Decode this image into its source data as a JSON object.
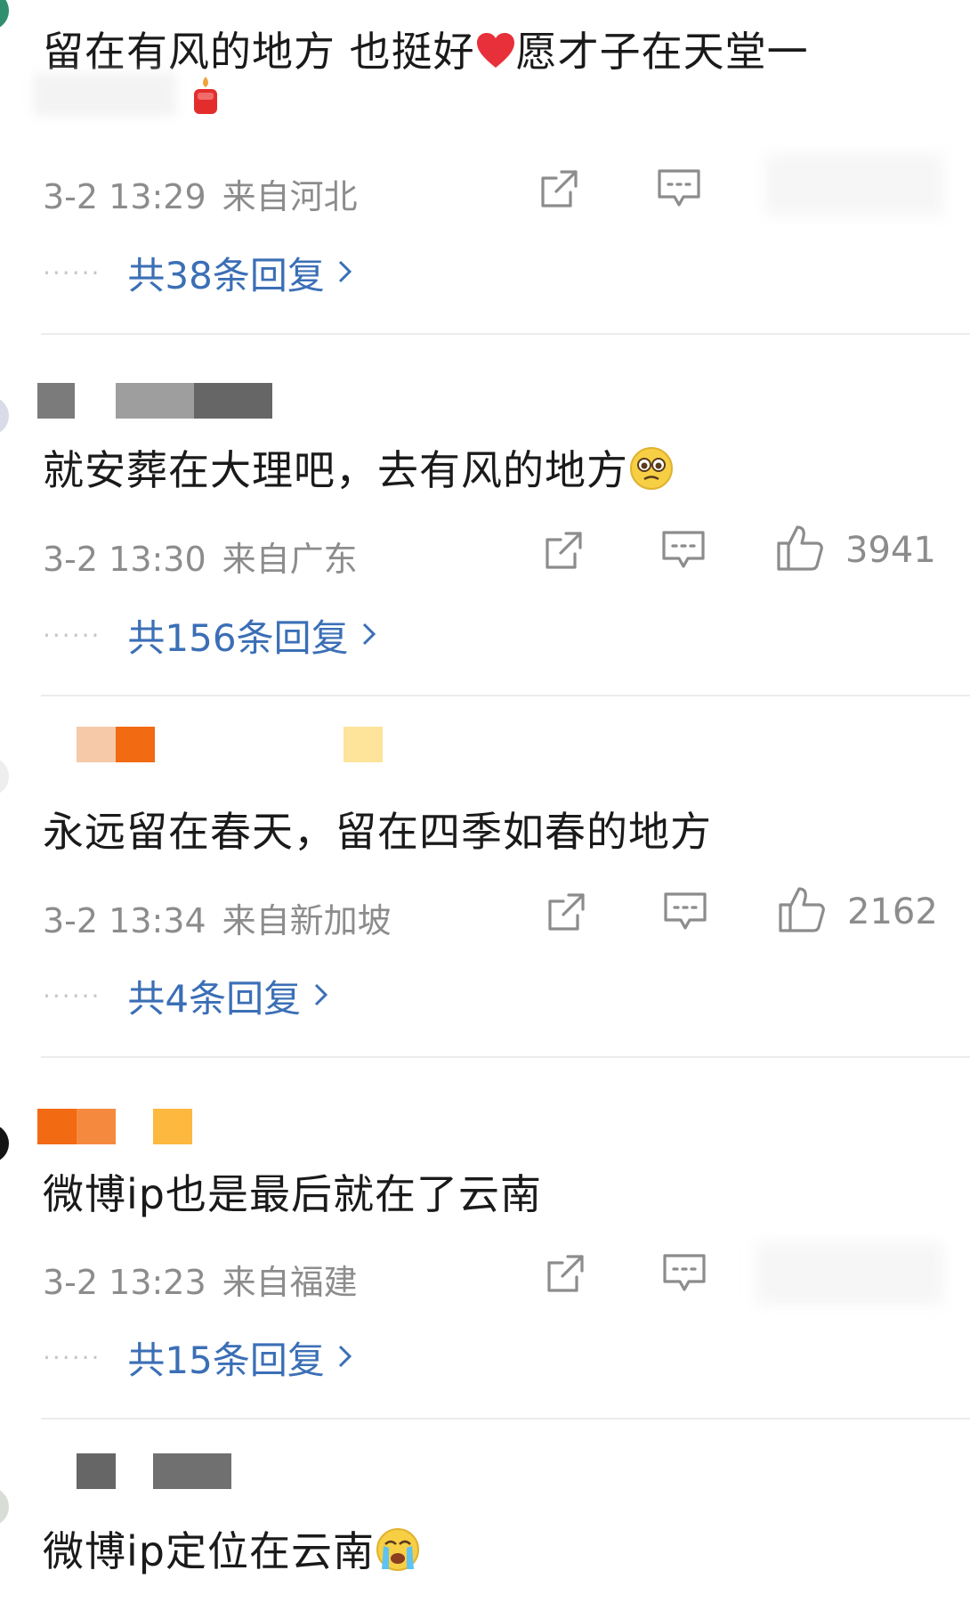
{
  "colors": {
    "text": "#1a1a1a",
    "meta": "#8c8c8c",
    "link": "#3b6fb6",
    "divider": "#ececec"
  },
  "icons": {
    "share": "share-icon",
    "comment": "comment-icon",
    "like": "like-icon",
    "heart": "heart-emoji",
    "pleading": "pleading-face-emoji",
    "crying": "crying-face-emoji",
    "candle": "candle-sticker"
  },
  "comments": [
    {
      "text_a": "留在有风的地方 也挺好",
      "text_b": "愿才子在天堂一",
      "time": "3-2 13:29",
      "location": "来自河北",
      "replies": "共38条回复"
    },
    {
      "text": "就安葬在大理吧，去有风的地方",
      "time": "3-2 13:30",
      "location": "来自广东",
      "likes": "3941",
      "replies": "共156条回复"
    },
    {
      "text": "永远留在春天，留在四季如春的地方",
      "time": "3-2 13:34",
      "location": "来自新加坡",
      "likes": "2162",
      "replies": "共4条回复"
    },
    {
      "text": "微博ip也是最后就在了云南",
      "time": "3-2 13:23",
      "location": "来自福建",
      "replies": "共15条回复"
    },
    {
      "text": "微博ip定位在云南"
    }
  ]
}
